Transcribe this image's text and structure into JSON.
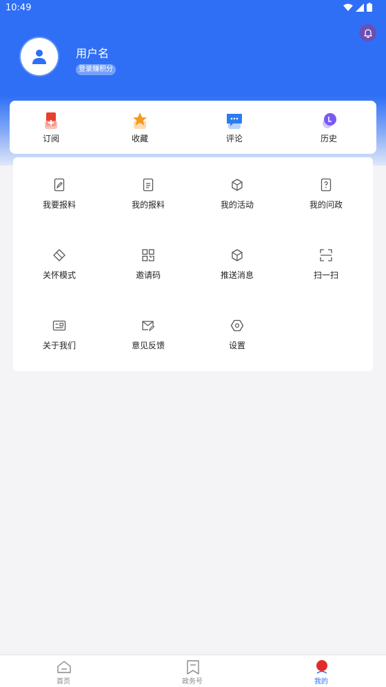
{
  "status_bar": {
    "time": "10:49"
  },
  "profile": {
    "username": "用户名",
    "points_badge": "登录赚积分"
  },
  "quick_actions": [
    {
      "label": "订阅",
      "icon": "subscribe-icon"
    },
    {
      "label": "收藏",
      "icon": "star-icon"
    },
    {
      "label": "评论",
      "icon": "comment-icon"
    },
    {
      "label": "历史",
      "icon": "history-icon"
    }
  ],
  "grid": [
    {
      "label": "我要报料",
      "icon": "edit-document-icon"
    },
    {
      "label": "我的报料",
      "icon": "document-icon"
    },
    {
      "label": "我的活动",
      "icon": "cube-icon"
    },
    {
      "label": "我的问政",
      "icon": "question-document-icon"
    },
    {
      "label": "关怀模式",
      "icon": "care-mode-icon"
    },
    {
      "label": "邀请码",
      "icon": "qr-grid-icon"
    },
    {
      "label": "推送消息",
      "icon": "cube-icon"
    },
    {
      "label": "扫一扫",
      "icon": "scan-icon"
    },
    {
      "label": "关于我们",
      "icon": "id-card-icon"
    },
    {
      "label": "意见反馈",
      "icon": "mail-edit-icon"
    },
    {
      "label": "设置",
      "icon": "hexagon-settings-icon"
    }
  ],
  "tabs": [
    {
      "label": "首页",
      "icon": "home-icon",
      "active": false
    },
    {
      "label": "政务号",
      "icon": "bookmark-icon",
      "active": false
    },
    {
      "label": "我的",
      "icon": "profile-icon",
      "active": true
    }
  ],
  "colors": {
    "primary": "#2f6ff5",
    "background": "#f4f4f6"
  }
}
